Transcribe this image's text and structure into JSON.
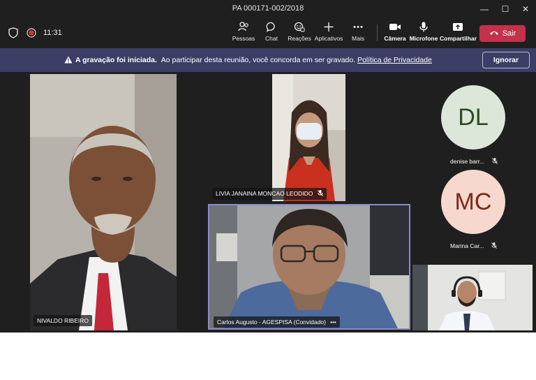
{
  "window": {
    "title": "PA 000171-002/2018",
    "minimize": "—",
    "maximize": "☐",
    "close": "✕"
  },
  "toolbar": {
    "time": "11:31",
    "items": [
      {
        "label": "Pessoas",
        "icon": "people-icon"
      },
      {
        "label": "Chat",
        "icon": "chat-icon"
      },
      {
        "label": "Reações",
        "icon": "reactions-icon"
      },
      {
        "label": "Aplicativos",
        "icon": "plus-icon"
      },
      {
        "label": "Mais",
        "icon": "more-icon"
      },
      {
        "label": "Câmera",
        "icon": "camera-icon"
      },
      {
        "label": "Microfone",
        "icon": "microphone-icon"
      },
      {
        "label": "Compartilhar",
        "icon": "share-icon"
      }
    ],
    "leave_label": "Sair",
    "leave_color": "#c4314b"
  },
  "banner": {
    "bold_text": "A gravação foi iniciada.",
    "text": "Ao participar desta reunião, você concorda em ser gravado.",
    "link": "Política de Privacidade",
    "dismiss_label": "Ignorar",
    "background": "#3d3e66"
  },
  "participants": {
    "nivaldo": "NIVALDO RIBEIRO",
    "livia": "LIVIA JANAINA MONCAO LEODIDO",
    "carlos": "Carlos Augusto - AGESPISA (Convidado)",
    "carlos_more": "•••",
    "denise": {
      "initials": "DL",
      "name": "denise barr...",
      "color": "#dce6d9",
      "text_color": "#2f4a25"
    },
    "marina": {
      "initials": "MC",
      "name": "Marina Car...",
      "color": "#f6d8cf",
      "text_color": "#7a2a18"
    }
  },
  "active_speaker_border": "#8b8cc7"
}
